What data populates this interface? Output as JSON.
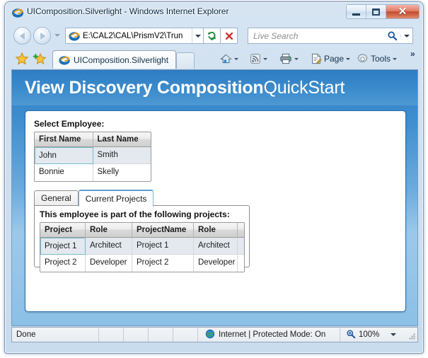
{
  "window": {
    "title": "UIComposition.Silverlight - Windows Internet Explorer",
    "icon": "ie-logo-icon",
    "buttons": {
      "minimize": "minimize-button",
      "maximize": "maximize-button",
      "close_label": "✕"
    }
  },
  "navbar": {
    "back": "back-button",
    "forward": "forward-button",
    "history_dropdown": "history-dropdown",
    "address": {
      "value": "E:\\CAL2\\CAL\\PrismV2\\Trun",
      "icon": "ie-logo-icon",
      "dropdown": "address-dropdown"
    },
    "refresh": "refresh-button",
    "stop": "stop-button",
    "search": {
      "placeholder": "Live Search",
      "icon": "magnifier-icon",
      "dropdown": "search-provider-dropdown"
    }
  },
  "tabbar": {
    "favorites_icon": "star-icon",
    "add_favorite_icon": "star-plus-icon",
    "tab_label": "UIComposition.Silverlight",
    "tab_icon": "ie-logo-icon",
    "new_tab": "new-tab-button",
    "commands": [
      {
        "name": "home",
        "label": "",
        "icon": "home-icon",
        "has_caret": true
      },
      {
        "name": "feeds",
        "label": "",
        "icon": "rss-icon",
        "has_caret": true
      },
      {
        "name": "print",
        "label": "",
        "icon": "printer-icon",
        "has_caret": true
      },
      {
        "name": "page",
        "label": "Page",
        "icon": "page-icon",
        "has_caret": true
      },
      {
        "name": "tools",
        "label": "Tools",
        "icon": "gear-icon",
        "has_caret": true
      }
    ],
    "overflow_label": "»"
  },
  "page": {
    "banner": {
      "title_bold": "View Discovery Composition",
      "title_light": "QuickStart"
    },
    "employee_section": {
      "label": "Select Employee:",
      "columns": [
        "First Name",
        "Last Name"
      ],
      "rows": [
        {
          "first": "John",
          "last": "Smith",
          "selected": true
        },
        {
          "first": "Bonnie",
          "last": "Skelly",
          "selected": false
        }
      ]
    },
    "tabs": [
      {
        "label": "General",
        "active": false
      },
      {
        "label": "Current Projects",
        "active": true
      }
    ],
    "projects_section": {
      "caption": "This employee is part of the following projects:",
      "columns": [
        "Project",
        "Role",
        "ProjectName",
        "Role",
        ""
      ],
      "rows": [
        {
          "c1": "Project 1",
          "c2": "Architect",
          "c3": "Project 1",
          "c4": "Architect",
          "c5": "",
          "selected": true
        },
        {
          "c1": "Project 2",
          "c2": "Developer",
          "c3": "Project 2",
          "c4": "Developer",
          "c5": "",
          "selected": false
        }
      ]
    }
  },
  "statusbar": {
    "status": "Done",
    "zone_icon": "globe-icon",
    "zone": "Internet | Protected Mode: On",
    "zoom_icon": "zoom-magnifier-icon",
    "zoom": "100%",
    "zoom_dropdown": "zoom-dropdown",
    "resize_grip": "resize-grip"
  },
  "colors": {
    "accent": "#3c8bcc",
    "banner_top": "#2e7cc3",
    "banner_bottom": "#4e99d4",
    "panel_border": "#2d6fae",
    "selection": "#e3e9ef",
    "close_button": "#c44a2e"
  }
}
